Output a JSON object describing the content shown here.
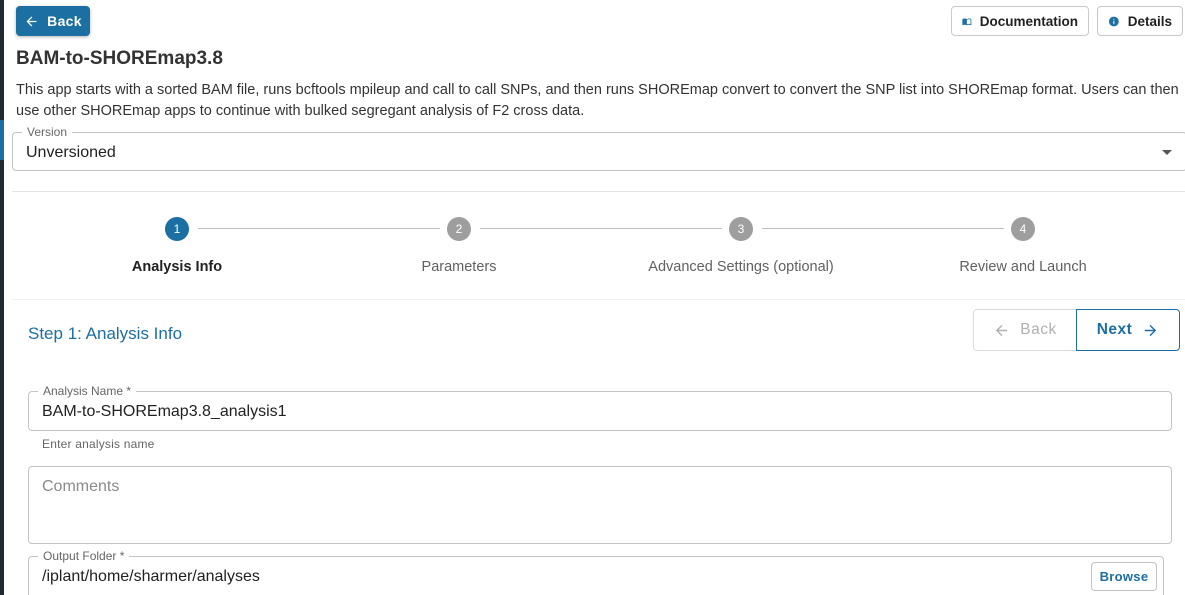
{
  "header": {
    "back_label": "Back",
    "documentation_label": "Documentation",
    "details_label": "Details"
  },
  "app": {
    "title": "BAM-to-SHOREmap3.8",
    "description": "This app starts with a sorted BAM file, runs bcftools mpileup and call to call SNPs, and then runs SHOREmap convert to convert the SNP list into SHOREmap format. Users can then use other SHOREmap apps to continue with bulked segregant analysis of F2 cross data."
  },
  "version": {
    "label": "Version",
    "value": "Unversioned"
  },
  "stepper": {
    "steps": [
      {
        "number": "1",
        "label": "Analysis Info",
        "active": true
      },
      {
        "number": "2",
        "label": "Parameters",
        "active": false
      },
      {
        "number": "3",
        "label": "Advanced Settings (optional)",
        "active": false
      },
      {
        "number": "4",
        "label": "Review and Launch",
        "active": false
      }
    ]
  },
  "step_form": {
    "heading": "Step 1: Analysis Info",
    "nav_back_label": "Back",
    "nav_next_label": "Next",
    "analysis_name": {
      "label": "Analysis Name *",
      "value": "BAM-to-SHOREmap3.8_analysis1",
      "helper": "Enter analysis name"
    },
    "comments": {
      "placeholder": "Comments"
    },
    "output_folder": {
      "label": "Output Folder *",
      "value": "/iplant/home/sharmer/analyses",
      "browse_label": "Browse"
    }
  },
  "colors": {
    "primary": "#1b6fa3",
    "inactive_step": "#9e9e9e",
    "border": "#c4c4c4"
  },
  "icons": {
    "back": "arrow-left-icon",
    "documentation": "book-icon",
    "details": "info-icon",
    "next": "arrow-right-icon",
    "version_dropdown": "caret-down-icon"
  }
}
